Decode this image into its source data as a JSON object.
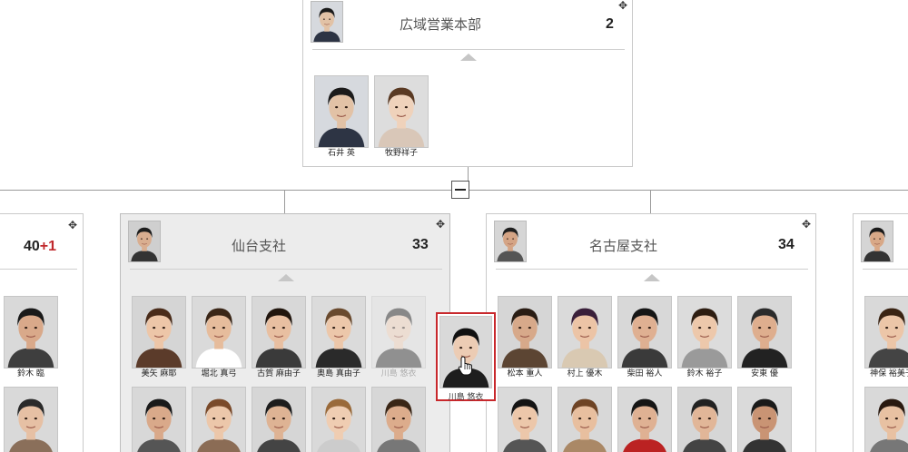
{
  "top_unit": {
    "title": "広域営業本部",
    "count": "2",
    "members": [
      {
        "name": "石井 英",
        "bg": "#d6d9de",
        "skin": "#e2c2a6",
        "hair": "#1b1b1b",
        "shirt": "#2d3444"
      },
      {
        "name": "牧野祥子",
        "bg": "#dddddd",
        "skin": "#efd2bb",
        "hair": "#5a3a23",
        "shirt": "#d9c7b8"
      }
    ]
  },
  "left_unit": {
    "count_main": "40",
    "count_plus": "+1",
    "members": [
      {
        "name": "鈴木 臨",
        "bg": "#d9d9d9",
        "skin": "#d9a98a",
        "hair": "#1a1a1a",
        "shirt": "#3e3e3e"
      },
      {
        "name": "",
        "bg": "#d9d9d9",
        "skin": "#e6c0a4",
        "hair": "#2a2a2a",
        "shirt": "#8a6f5a"
      }
    ]
  },
  "sendai_unit": {
    "title": "仙台支社",
    "count": "33",
    "members_row1": [
      {
        "name": "美矢 麻耶",
        "bg": "#d5d5d5",
        "skin": "#edc6a8",
        "hair": "#4a2c1a",
        "shirt": "#5b3b2a",
        "faded": false
      },
      {
        "name": "堀北 真弓",
        "bg": "#dadada",
        "skin": "#e6bc9c",
        "hair": "#3a2617",
        "shirt": "#ffffff",
        "faded": false
      },
      {
        "name": "古賀 麻由子",
        "bg": "#d8d8d8",
        "skin": "#e8bfa1",
        "hair": "#21160e",
        "shirt": "#3a3a3a",
        "faded": false
      },
      {
        "name": "奥島 真由子",
        "bg": "#dbdbdb",
        "skin": "#ecc7aa",
        "hair": "#6a4a2e",
        "shirt": "#2a2a2a",
        "faded": false
      },
      {
        "name": "川島 悠衣",
        "bg": "#dddddd",
        "skin": "#ecccb4",
        "hair": "#111111",
        "shirt": "#222222",
        "faded": true
      }
    ],
    "members_row2": [
      {
        "bg": "#d8d8d8",
        "skin": "#d9a98a",
        "hair": "#1a1a1a",
        "shirt": "#555555"
      },
      {
        "bg": "#dadada",
        "skin": "#ecc7aa",
        "hair": "#7a4a2a",
        "shirt": "#8b6c55"
      },
      {
        "bg": "#d6d6d6",
        "skin": "#deb394",
        "hair": "#1d1d1d",
        "shirt": "#444444"
      },
      {
        "bg": "#d9d9d9",
        "skin": "#efcdb2",
        "hair": "#9a6a3a",
        "shirt": "#cccccc"
      },
      {
        "bg": "#d7d7d7",
        "skin": "#dcac8c",
        "hair": "#3a2616",
        "shirt": "#777777"
      }
    ]
  },
  "dragging_member": {
    "name": "川島 悠衣",
    "bg": "#d9d9d9",
    "skin": "#ecccb4",
    "hair": "#111111",
    "shirt": "#1e1e1e"
  },
  "nagoya_unit": {
    "title": "名古屋支社",
    "count": "34",
    "members_row1": [
      {
        "name": "松本 重人",
        "bg": "#d6d6d6",
        "skin": "#d7a98a",
        "hair": "#2a1d14",
        "shirt": "#5c4533"
      },
      {
        "name": "村上 優木",
        "bg": "#dadada",
        "skin": "#ecc4a6",
        "hair": "#3a1f3a",
        "shirt": "#d9c9b2"
      },
      {
        "name": "柴田 裕人",
        "bg": "#d8d8d8",
        "skin": "#dfb092",
        "hair": "#161616",
        "shirt": "#3a3a3a"
      },
      {
        "name": "鈴木 裕子",
        "bg": "#dcdcdc",
        "skin": "#edc8ab",
        "hair": "#2e1e12",
        "shirt": "#9a9a9a"
      },
      {
        "name": "安東 優",
        "bg": "#d7d7d7",
        "skin": "#deae8e",
        "hair": "#2b2b2b",
        "shirt": "#222222"
      }
    ],
    "members_row2": [
      {
        "bg": "#dadada",
        "skin": "#ecc7aa",
        "hair": "#141414",
        "shirt": "#555555"
      },
      {
        "bg": "#d8d8d8",
        "skin": "#e8bf9f",
        "hair": "#6e4425",
        "shirt": "#aa8866"
      },
      {
        "bg": "#d9d9d9",
        "skin": "#dfb193",
        "hair": "#151515",
        "shirt": "#bb2222"
      },
      {
        "bg": "#d6d6d6",
        "skin": "#e1b698",
        "hair": "#222222",
        "shirt": "#444444"
      },
      {
        "bg": "#dadada",
        "skin": "#c99474",
        "hair": "#1a1a1a",
        "shirt": "#333333"
      }
    ]
  },
  "right_unit": {
    "members": [
      {
        "name": "神保 裕美子",
        "bg": "#d9d9d9",
        "skin": "#ecc6a8",
        "hair": "#3a2414",
        "shirt": "#444444"
      },
      {
        "name": "",
        "bg": "#d9d9d9",
        "skin": "#e8c1a2",
        "hair": "#2a1a10",
        "shirt": "#777777"
      }
    ],
    "head": {
      "bg": "#d5d5d5",
      "skin": "#d8a887",
      "hair": "#1a1a1a",
      "shirt": "#333333"
    }
  },
  "heads": {
    "top": {
      "bg": "#d6d9de",
      "skin": "#e2c2a6",
      "hair": "#1b1b1b",
      "shirt": "#2d3444"
    },
    "sendai": {
      "bg": "#cfcfcf",
      "skin": "#d9ae90",
      "hair": "#1e1e1e",
      "shirt": "#333333"
    },
    "nagoya": {
      "bg": "#d6d6d6",
      "skin": "#d4a485",
      "hair": "#1f1f1f",
      "shirt": "#555555"
    }
  },
  "colors": {
    "accent": "#c8282c"
  }
}
